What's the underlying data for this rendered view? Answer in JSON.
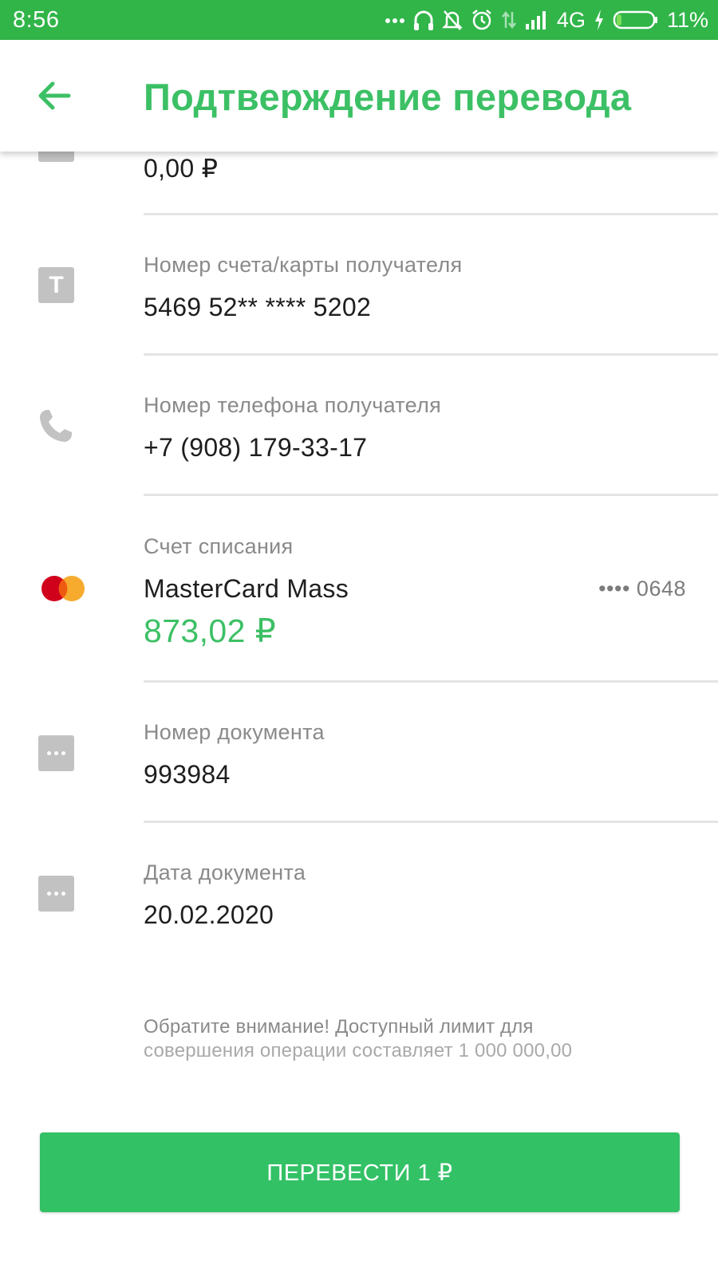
{
  "status_bar": {
    "time": "8:56",
    "network": "4G",
    "battery": "11%",
    "icons": [
      "more-dots-icon",
      "headphones-icon",
      "mute-bell-icon",
      "alarm-icon",
      "data-arrows-icon",
      "signal-icon",
      "charging-icon",
      "battery-icon"
    ]
  },
  "header": {
    "back_icon": "arrow-left-icon",
    "title": "Подтверждение перевода"
  },
  "fields": {
    "commission": {
      "value": "0,00 ₽"
    },
    "recipient_account": {
      "label": "Номер счета/карты получателя",
      "value": "5469 52** **** 5202",
      "icon": "T"
    },
    "recipient_phone": {
      "label": "Номер телефона получателя",
      "value": "+7 (908) 179-33-17"
    },
    "debit_account": {
      "label": "Счет списания",
      "card_name": "MasterCard Mass",
      "card_mask": "•••• 0648",
      "balance": "873,02 ₽"
    },
    "document_number": {
      "label": "Номер документа",
      "value": "993984"
    },
    "document_date": {
      "label": "Дата документа",
      "value": "20.02.2020"
    }
  },
  "notice": {
    "line1": "Обратите внимание! Доступный лимит для",
    "line2": "совершения операции составляет 1 000 000,00"
  },
  "action": {
    "label": "ПЕРЕВЕСТИ 1 ₽"
  },
  "colors": {
    "status_bar": "#31b549",
    "accent": "#3cc065",
    "button": "#33c166",
    "icon_gray": "#c2c2c2"
  }
}
